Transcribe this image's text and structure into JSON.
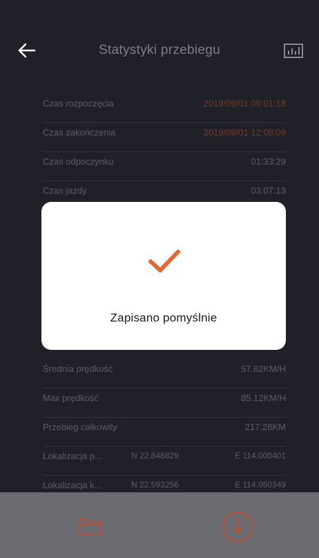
{
  "header": {
    "title": "Statystyki przebiegu"
  },
  "stats_top": [
    {
      "label": "Czas rozpoczęcia",
      "value": "2019/09/01 09:01:18"
    },
    {
      "label": "Czas zakończenia",
      "value": "2019/09/01 12:08:09"
    },
    {
      "label": "Czas odpoczynku",
      "value": "01:33:29"
    },
    {
      "label": "Czas jazdy",
      "value": "03:07:13"
    }
  ],
  "stats_bottom": [
    {
      "label": "Średnia prędkość",
      "value": "57.62KM/H"
    },
    {
      "label": "Max prędkość",
      "value": "85.12KM/H"
    },
    {
      "label": "Przebieg całkowity",
      "value": "217.28KM"
    }
  ],
  "locations": [
    {
      "label": "Lokalizacja p...",
      "lat": "N 22.648829",
      "lon": "E 114.000401"
    },
    {
      "label": "Lokalizacja k...",
      "lat": "N 22.593256",
      "lon": "E 114.050349"
    }
  ],
  "dialog": {
    "message": "Zapisano pomyślnie"
  },
  "colors": {
    "background": "#1f2028",
    "accent": "#e06a35",
    "bottom_bar": "#6a6c72"
  }
}
